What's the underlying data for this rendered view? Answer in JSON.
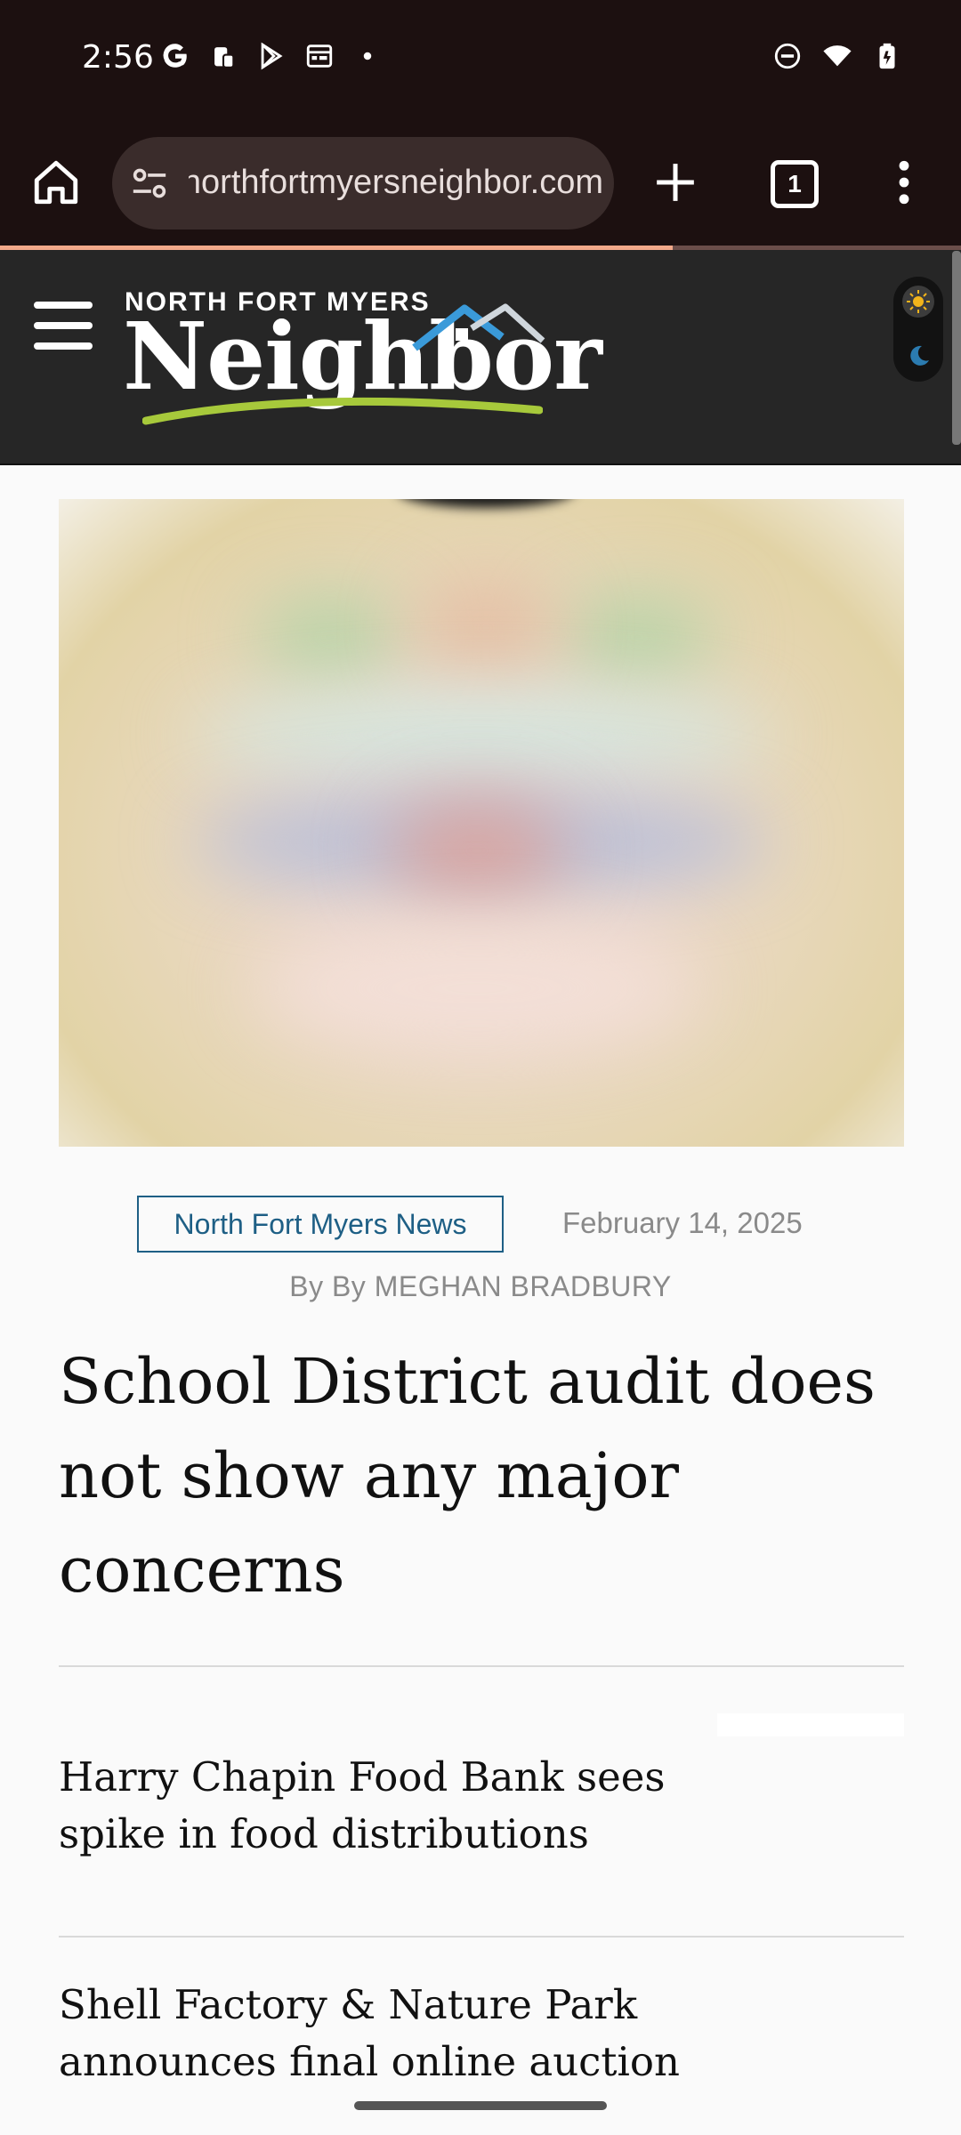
{
  "status_bar": {
    "time": "2:56",
    "left_icons": [
      "google-icon",
      "work-profile-icon",
      "play-store-icon",
      "calendar-icon",
      "dot-icon"
    ],
    "right_icons": [
      "do-not-disturb-icon",
      "wifi-icon",
      "battery-icon"
    ]
  },
  "browser": {
    "url": "northfortmyersneighbor.com",
    "tab_count": "1",
    "load_progress": 0.7
  },
  "site": {
    "logo_top": "NORTH FORT MYERS",
    "logo_main": "Neighbor"
  },
  "article": {
    "category": "North Fort Myers News",
    "date": "February 14, 2025",
    "byline": "By By MEGHAN BRADBURY",
    "headline_lines": [
      "School District audit does",
      "not show any major",
      "concerns"
    ]
  },
  "related": [
    {
      "lines": [
        "Harry Chapin Food Bank sees",
        "spike in food distributions"
      ]
    },
    {
      "lines": [
        "Shell Factory & Nature Park",
        "announces final online auction"
      ]
    }
  ],
  "colors": {
    "browser_bg": "#1c1010",
    "site_header_bg": "#262626",
    "accent_blue": "#1e5f85",
    "progress": "#f2a98a"
  }
}
